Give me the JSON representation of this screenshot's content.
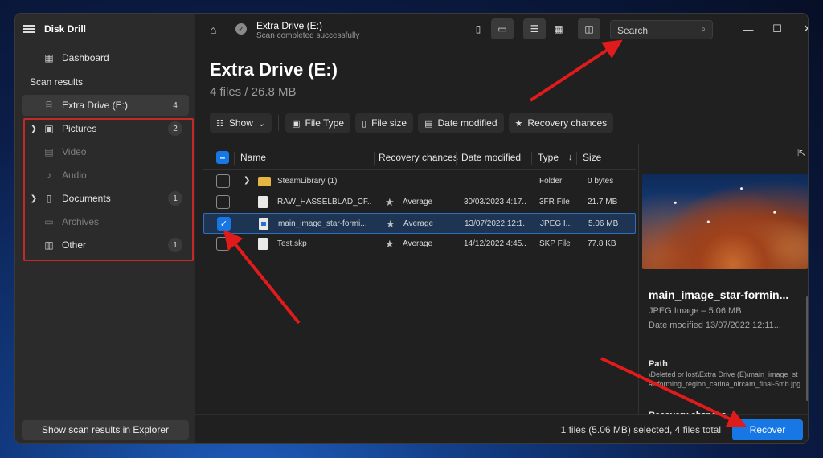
{
  "app": {
    "title": "Disk Drill"
  },
  "sidebar": {
    "dashboard": "Dashboard",
    "scan_results_label": "Scan results",
    "drive": {
      "label": "Extra Drive (E:)",
      "count": "4"
    },
    "categories": [
      {
        "label": "Pictures",
        "count": "2",
        "icon": "image-icon",
        "enabled": true
      },
      {
        "label": "Video",
        "count": "",
        "icon": "film-icon",
        "enabled": false
      },
      {
        "label": "Audio",
        "count": "",
        "icon": "music-note-icon",
        "enabled": false
      },
      {
        "label": "Documents",
        "count": "1",
        "icon": "document-icon",
        "enabled": true
      },
      {
        "label": "Archives",
        "count": "",
        "icon": "archive-icon",
        "enabled": false
      },
      {
        "label": "Other",
        "count": "1",
        "icon": "other-file-icon",
        "enabled": true
      }
    ],
    "explorer_button": "Show scan results in Explorer"
  },
  "topbar": {
    "drive_title": "Extra Drive (E:)",
    "drive_status": "Scan completed successfully",
    "search_placeholder": "Search"
  },
  "header": {
    "title": "Extra Drive (E:)",
    "subtitle": "4 files / 26.8 MB"
  },
  "filters": {
    "show": "Show",
    "file_type": "File Type",
    "file_size": "File size",
    "date_modified": "Date modified",
    "recovery_chances": "Recovery chances"
  },
  "table": {
    "columns": {
      "name": "Name",
      "recovery": "Recovery chances",
      "date": "Date modified",
      "type": "Type",
      "size": "Size"
    },
    "rows": [
      {
        "name": "SteamLibrary (1)",
        "recovery": "",
        "date": "",
        "type": "Folder",
        "size": "0 bytes",
        "selected": false
      },
      {
        "name": "RAW_HASSELBLAD_CF...",
        "recovery": "Average",
        "date": "30/03/2023 4:17...",
        "type": "3FR File",
        "size": "21.7 MB",
        "selected": false
      },
      {
        "name": "main_image_star-formi...",
        "recovery": "Average",
        "date": "13/07/2022 12:1...",
        "type": "JPEG I...",
        "size": "5.06 MB",
        "selected": true
      },
      {
        "name": "Test.skp",
        "recovery": "Average",
        "date": "14/12/2022 4:45...",
        "type": "SKP File",
        "size": "77.8 KB",
        "selected": false
      }
    ]
  },
  "preview": {
    "name": "main_image_star-formin...",
    "kind": "JPEG Image – 5.06 MB",
    "date": "Date modified 13/07/2022 12:11...",
    "path_label": "Path",
    "path": "\\Deleted or lost\\Extra Drive (E)\\main_image_star-forming_region_carina_nircam_final-5mb.jpg",
    "recovery_label": "Recovery chances"
  },
  "bottom": {
    "status": "1 files (5.06 MB) selected, 4 files total",
    "recover": "Recover"
  },
  "colors": {
    "accent": "#1677e5",
    "highlight": "#c62828"
  }
}
